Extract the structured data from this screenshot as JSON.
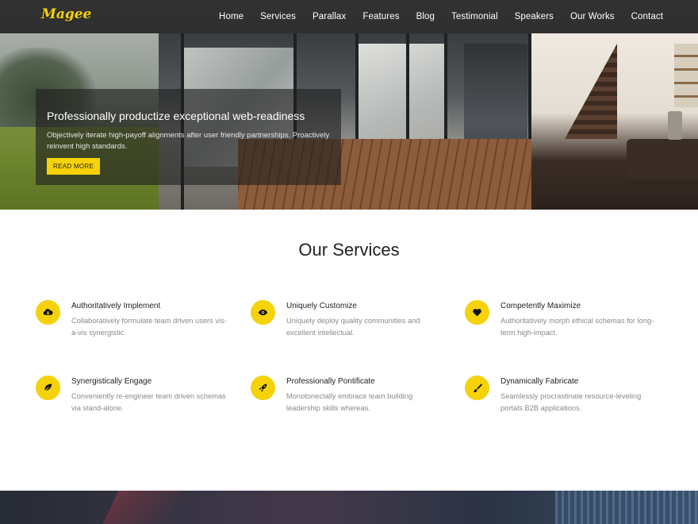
{
  "brand": {
    "logo": "Magee",
    "accent_color": "#f5d20a"
  },
  "nav": {
    "items": [
      "Home",
      "Services",
      "Parallax",
      "Features",
      "Blog",
      "Testimonial",
      "Speakers",
      "Our Works",
      "Contact"
    ]
  },
  "hero": {
    "title": "Professionally productize exceptional web-readiness",
    "text": "Objectively iterate high-payoff alignments after user friendly partnerships. Proactively reinvent high standards.",
    "button_label": "READ MORE"
  },
  "services": {
    "title": "Our Services",
    "items": [
      {
        "icon": "cloud-download-icon",
        "title": "Authoritatively Implement",
        "text": "Collaboratively formulate team driven users vis-a-vis synergistic."
      },
      {
        "icon": "eye-icon",
        "title": "Uniquely Customize",
        "text": "Uniquely deploy quality communities and excellent intellectual."
      },
      {
        "icon": "heart-icon",
        "title": "Competently Maximize",
        "text": "Authoritatively morph ethical schemas for long-term high-impact."
      },
      {
        "icon": "leaf-icon",
        "title": "Synergistically Engage",
        "text": "Conveniently re-engineer team driven schemas via stand-alone."
      },
      {
        "icon": "rocket-icon",
        "title": "Professionally Pontificate",
        "text": "Monotonectally embrace team building leadership skills whereas."
      },
      {
        "icon": "paintbrush-icon",
        "title": "Dynamically Fabricate",
        "text": "Seamlessly procrastinate resource-leveling portals B2B applications."
      }
    ]
  }
}
